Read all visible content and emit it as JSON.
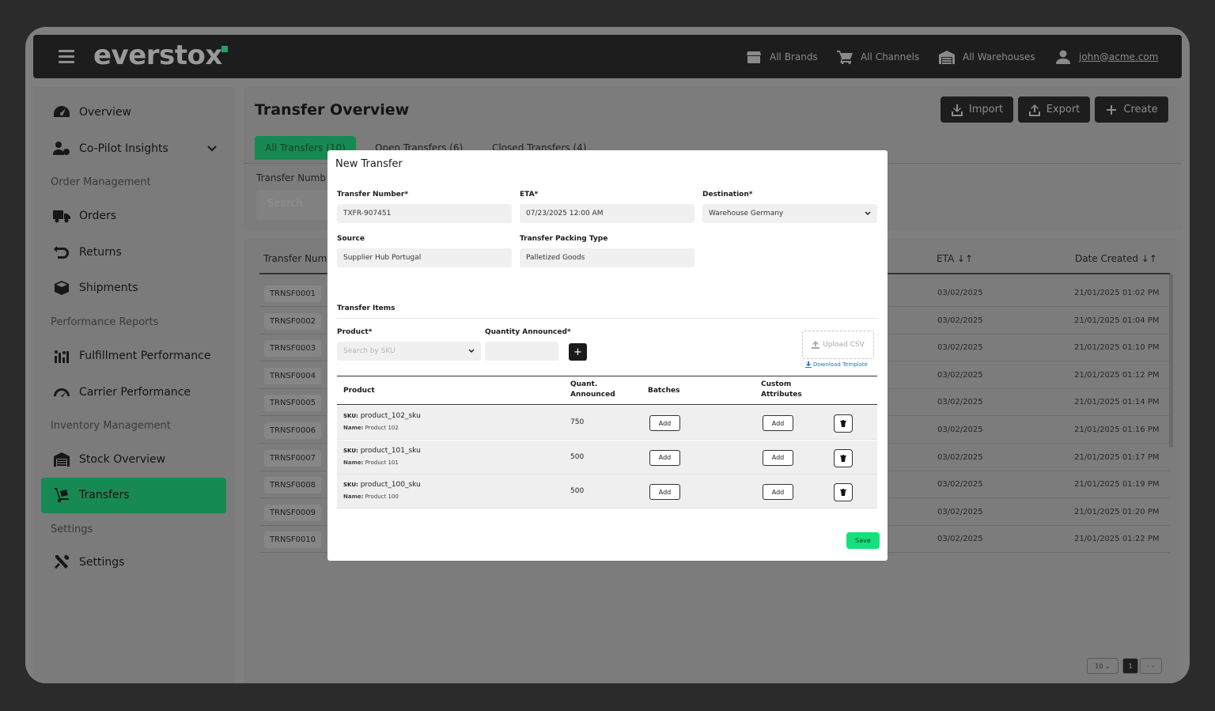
{
  "app": {
    "logo": "everstox",
    "nav": {
      "brands": "All Brands",
      "channels": "All Channels",
      "warehouses": "All Warehouses",
      "user": "john@acme.com"
    }
  },
  "sidebar": {
    "overview": "Overview",
    "copilot": "Co-Pilot Insights",
    "order_mgmt": "Order Management",
    "orders": "Orders",
    "returns": "Returns",
    "shipments": "Shipments",
    "perf_reports": "Performance Reports",
    "fulfillment": "Fulfillment Performance",
    "carrier": "Carrier Performance",
    "inventory_mgmt": "Inventory Management",
    "stock": "Stock Overview",
    "transfers": "Transfers",
    "settings_head": "Settings",
    "settings": "Settings"
  },
  "page": {
    "title": "Transfer Overview",
    "import": "Import",
    "export": "Export",
    "create": "Create",
    "tabs": [
      "All Transfers (10)",
      "Open Transfers (6)",
      "Closed Transfers (4)"
    ],
    "filter_label": "Transfer Numb",
    "search_placeholder": "Search"
  },
  "table": {
    "col_number": "Transfer Num",
    "col_eta": "ETA ↓↑",
    "col_date": "Date Created ↓↑",
    "rows": [
      {
        "id": "TRNSF0001",
        "eta": "03/02/2025",
        "created": "21/01/2025 01:02 PM"
      },
      {
        "id": "TRNSF0002",
        "eta": "03/02/2025",
        "created": "21/01/2025 01:04 PM"
      },
      {
        "id": "TRNSF0003",
        "eta": "03/02/2025",
        "created": "21/01/2025 01:10 PM"
      },
      {
        "id": "TRNSF0004",
        "eta": "03/02/2025",
        "created": "21/01/2025 01:12 PM"
      },
      {
        "id": "TRNSF0005",
        "eta": "03/02/2025",
        "created": "21/01/2025 01:14 PM"
      },
      {
        "id": "TRNSF0006",
        "eta": "03/02/2025",
        "created": "21/01/2025 01:16 PM"
      },
      {
        "id": "TRNSF0007",
        "eta": "03/02/2025",
        "created": "21/01/2025 01:17 PM"
      },
      {
        "id": "TRNSF0008",
        "eta": "03/02/2025",
        "created": "21/01/2025 01:19 PM"
      },
      {
        "id": "TRNSF0009",
        "eta": "03/02/2025",
        "created": "21/01/2025 01:20 PM"
      },
      {
        "id": "TRNSF0010",
        "eta": "03/02/2025",
        "created": "21/01/2025 01:22 PM"
      }
    ]
  },
  "pager": {
    "size": "10",
    "page": "1",
    "next": "› »"
  },
  "modal": {
    "title": "New Transfer",
    "transfer_number_label": "Transfer Number*",
    "transfer_number": "TXFR-907451",
    "eta_label": "ETA*",
    "eta": "07/23/2025 12:00 AM",
    "destination_label": "Destination*",
    "destination": "Warehouse Germany",
    "source_label": "Source",
    "source": "Supplier Hub Portugal",
    "packing_label": "Transfer Packing Type",
    "packing": "Palletized Goods",
    "items_title": "Transfer Items",
    "product_label": "Product*",
    "product_placeholder": "Search by SKU",
    "qty_label": "Quantity Announced*",
    "plus": "+",
    "upload_csv": "Upload CSV",
    "download_template": "Download Template",
    "col_product": "Product",
    "col_qty": "Quant. Announced",
    "col_batches": "Batches",
    "col_custom": "Custom Attributes",
    "sku_prefix": "SKU:",
    "name_prefix": "Name:",
    "add": "Add",
    "items": [
      {
        "sku": "product_102_sku",
        "name": "Product 102",
        "qty": "750"
      },
      {
        "sku": "product_101_sku",
        "name": "Product 101",
        "qty": "500"
      },
      {
        "sku": "product_100_sku",
        "name": "Product 100",
        "qty": "500"
      }
    ],
    "save": "Save"
  },
  "colors": {
    "accent": "#168a52",
    "save": "#14e07c",
    "link": "#2a6fd6"
  }
}
